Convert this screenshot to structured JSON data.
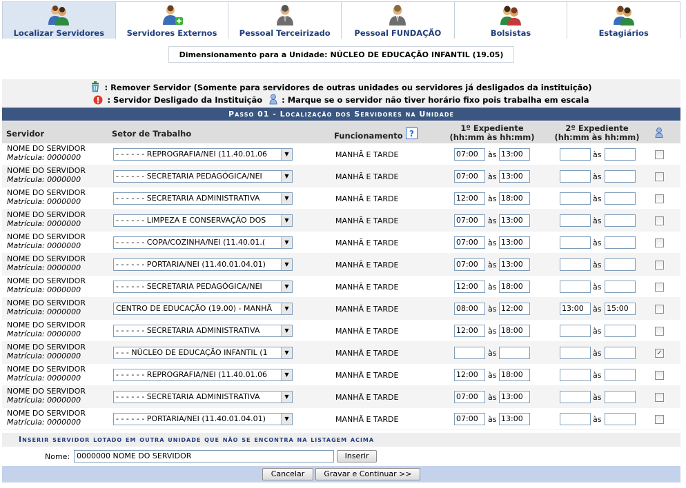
{
  "tabs": [
    {
      "label": "Localizar Servidores",
      "icon": "users-search-icon",
      "active": true
    },
    {
      "label": "Servidores Externos",
      "icon": "user-add-icon",
      "active": false
    },
    {
      "label": "Pessoal Terceirizado",
      "icon": "user-suit-icon",
      "active": false
    },
    {
      "label": "Pessoal FUNDAÇÃO",
      "icon": "user-suit-icon",
      "active": false
    },
    {
      "label": "Bolsistas",
      "icon": "users-icon",
      "active": false
    },
    {
      "label": "Estagiários",
      "icon": "users-icon",
      "active": false
    }
  ],
  "unit": {
    "label": "Dimensionamento para a Unidade:",
    "name": "NÚCLEO DE EDUCAÇÃO INFANTIL (19.05)"
  },
  "legend": {
    "remove_text": ": Remover Servidor (Somente para servidores de outras unidades ou servidores já desligados da instituição)",
    "desligado_text": ": Servidor Desligado da Instituição",
    "escala_text": ": Marque se o servidor não tiver horário fixo pois trabalha em escala"
  },
  "step_title": "Passo 01 - Localização dos Servidores na Unidade",
  "headers": {
    "servidor": "Servidor",
    "setor": "Setor de Trabalho",
    "funcionamento": "Funcionamento",
    "exp1_line1": "1º Expediente",
    "exp1_line2": "(hh:mm às hh:mm)",
    "exp2_line1": "2º Expediente",
    "exp2_line2": "(hh:mm às hh:mm)"
  },
  "rows": [
    {
      "name": "NOME DO SERVIDOR",
      "matricula": "Matrícula: 0000000",
      "setor": "- - - - - - REPROGRAFIA/NEI (11.40.01.06",
      "func": "MANHÃ E TARDE",
      "e1_start": "07:00",
      "e1_end": "13:00",
      "e2_start": "",
      "e2_end": "",
      "escala": false,
      "as": "às"
    },
    {
      "name": "NOME DO SERVIDOR",
      "matricula": "Matrícula: 0000000",
      "setor": "- - - - - - SECRETARIA PEDAGÓGICA/NEI",
      "func": "MANHÃ E TARDE",
      "e1_start": "07:00",
      "e1_end": "13:00",
      "e2_start": "",
      "e2_end": "",
      "escala": false,
      "as": "às"
    },
    {
      "name": "NOME DO SERVIDOR",
      "matricula": "Matrícula: 0000000",
      "setor": "- - - - - - SECRETARIA ADMINISTRATIVA",
      "func": "MANHÃ E TARDE",
      "e1_start": "12:00",
      "e1_end": "18:00",
      "e2_start": "",
      "e2_end": "",
      "escala": false,
      "as": "às"
    },
    {
      "name": "NOME DO SERVIDOR",
      "matricula": "Matrícula: 0000000",
      "setor": "- - - - - - LIMPEZA E CONSERVAÇÃO DOS",
      "func": "MANHÃ E TARDE",
      "e1_start": "07:00",
      "e1_end": "13:00",
      "e2_start": "",
      "e2_end": "",
      "escala": false,
      "as": "às"
    },
    {
      "name": "NOME DO SERVIDOR",
      "matricula": "Matrícula: 0000000",
      "setor": "- - - - - - COPA/COZINHA/NEI (11.40.01.(",
      "func": "MANHÃ E TARDE",
      "e1_start": "07:00",
      "e1_end": "13:00",
      "e2_start": "",
      "e2_end": "",
      "escala": false,
      "as": "às"
    },
    {
      "name": "NOME DO SERVIDOR",
      "matricula": "Matrícula: 0000000",
      "setor": "- - - - - - PORTARIA/NEI (11.40.01.04.01)",
      "func": "MANHÃ E TARDE",
      "e1_start": "07:00",
      "e1_end": "13:00",
      "e2_start": "",
      "e2_end": "",
      "escala": false,
      "as": "às"
    },
    {
      "name": "NOME DO SERVIDOR",
      "matricula": "Matrícula: 0000000",
      "setor": "- - - - - - SECRETARIA PEDAGÓGICA/NEI",
      "func": "MANHÃ E TARDE",
      "e1_start": "12:00",
      "e1_end": "18:00",
      "e2_start": "",
      "e2_end": "",
      "escala": false,
      "as": "às"
    },
    {
      "name": "NOME DO SERVIDOR",
      "matricula": "Matrícula: 0000000",
      "setor": "CENTRO DE EDUCAÇÃO (19.00) - MANHÃ",
      "func": "MANHÃ E TARDE",
      "e1_start": "08:00",
      "e1_end": "12:00",
      "e2_start": "13:00",
      "e2_end": "15:00",
      "escala": false,
      "as": "às"
    },
    {
      "name": "NOME DO SERVIDOR",
      "matricula": "Matrícula: 0000000",
      "setor": "- - - - - - SECRETARIA ADMINISTRATIVA",
      "func": "MANHÃ E TARDE",
      "e1_start": "12:00",
      "e1_end": "18:00",
      "e2_start": "",
      "e2_end": "",
      "escala": false,
      "as": "às"
    },
    {
      "name": "NOME DO SERVIDOR",
      "matricula": "Matrícula: 0000000",
      "setor": "- - - NÚCLEO DE EDUCAÇÃO INFANTIL (1",
      "func": "MANHÃ E TARDE",
      "e1_start": "",
      "e1_end": "",
      "e2_start": "",
      "e2_end": "",
      "escala": true,
      "as": "às"
    },
    {
      "name": "NOME DO SERVIDOR",
      "matricula": "Matrícula: 0000000",
      "setor": "- - - - - - REPROGRAFIA/NEI (11.40.01.06",
      "func": "MANHÃ E TARDE",
      "e1_start": "12:00",
      "e1_end": "18:00",
      "e2_start": "",
      "e2_end": "",
      "escala": false,
      "as": "às"
    },
    {
      "name": "NOME DO SERVIDOR",
      "matricula": "Matrícula: 0000000",
      "setor": "- - - - - - SECRETARIA ADMINISTRATIVA",
      "func": "MANHÃ E TARDE",
      "e1_start": "07:00",
      "e1_end": "13:00",
      "e2_start": "",
      "e2_end": "",
      "escala": false,
      "as": "às"
    },
    {
      "name": "NOME DO SERVIDOR",
      "matricula": "Matrícula: 0000000",
      "setor": "- - - - - - PORTARIA/NEI (11.40.01.04.01)",
      "func": "MANHÃ E TARDE",
      "e1_start": "07:00",
      "e1_end": "13:00",
      "e2_start": "",
      "e2_end": "",
      "escala": false,
      "as": "às"
    }
  ],
  "insert": {
    "title": "Inserir servidor lotado em outra unidade que não se encontra na listagem acima",
    "nome_label": "Nome:",
    "nome_value": "0000000 NOME DO SERVIDOR",
    "inserir_label": "Inserir"
  },
  "footer": {
    "cancelar_label": "Cancelar",
    "gravar_label": "Gravar e Continuar >>"
  },
  "colors": {
    "step_bar": "#3b5681",
    "tab_active": "#dce6f3",
    "footer_bar": "#c4d2eb",
    "link_blue": "#213e7b"
  }
}
